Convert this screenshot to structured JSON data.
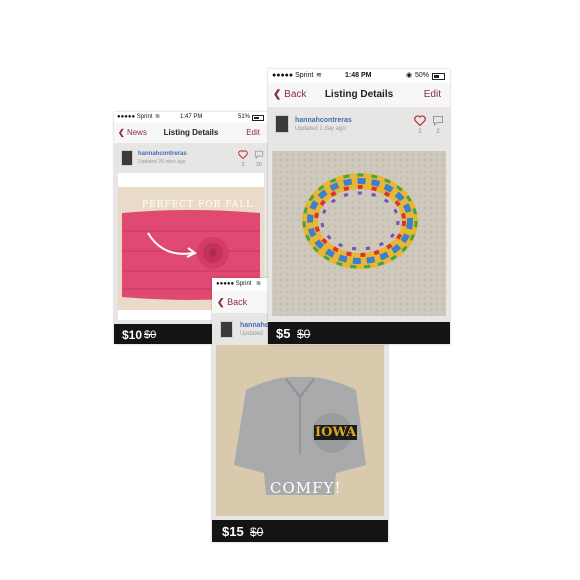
{
  "cards": {
    "left": {
      "status": {
        "carrier": "●●●●● Sprint",
        "time": "1:47 PM",
        "battery": "51%",
        "battery_level": 0.51
      },
      "nav": {
        "back": "News",
        "title": "Listing Details",
        "edit": "Edit"
      },
      "user": {
        "name": "hannahcontreras",
        "updated": "Updated 26 mins ago",
        "likes": "3",
        "comments": "20"
      },
      "photo_caption": "PERFECT FOR FALL",
      "price": "$10",
      "original_price": "$0"
    },
    "right": {
      "status": {
        "carrier": "●●●●● Sprint",
        "time": "1:48 PM",
        "battery": "50%",
        "battery_level": 0.5
      },
      "nav": {
        "back": "Back",
        "title": "Listing Details",
        "edit": "Edit"
      },
      "user": {
        "name": "hannahcontreras",
        "updated": "Updated 1 day ago",
        "likes": "2",
        "comments": "2"
      },
      "price": "$5",
      "original_price": "$0"
    },
    "bottom": {
      "status": {
        "carrier": "●●●●● Sprint"
      },
      "nav": {
        "back": "Back"
      },
      "user": {
        "name": "hannahcontreras",
        "updated": "Updated"
      },
      "photo_logo": "IOWA",
      "photo_caption": "COMFY!",
      "price": "$15",
      "original_price": "$0"
    }
  },
  "colors": {
    "accent": "#8b2c3e",
    "link": "#3f6fb0",
    "price_bar": "#141414",
    "heart": "#b8353f"
  }
}
